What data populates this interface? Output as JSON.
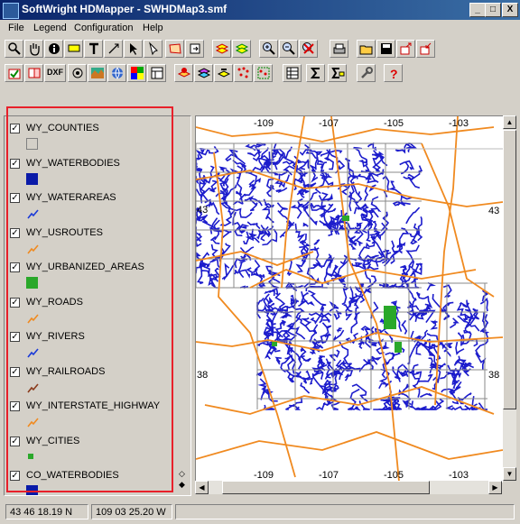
{
  "window": {
    "title": "SoftWright HDMapper - SWHDMap3.smf",
    "minimize": "_",
    "maximize": "□",
    "close": "X"
  },
  "menu": {
    "items": [
      "File",
      "Legend",
      "Configuration",
      "Help"
    ]
  },
  "toolbar1": [
    "zoom-window-icon",
    "pan-hand-icon",
    "info-icon",
    "label-icon",
    "text-tool-icon",
    "measure-icon",
    "select-arrow-icon",
    "edit-pointer-icon",
    "polygon-icon",
    "refresh-icon",
    "layers-up-icon",
    "layers-down-icon",
    "zoom-in-icon",
    "zoom-out-icon",
    "zoom-cancel-icon",
    "print-icon",
    "open-folder-icon",
    "save-icon",
    "export-icon",
    "import-icon"
  ],
  "toolbar2": {
    "dxf_label": "DXF",
    "icons": [
      "check-map-icon",
      "convert-icon",
      "dxf-icon",
      "target-icon",
      "terrain-icon",
      "globe-icon",
      "grid-color-icon",
      "layout-icon",
      "layer-add-icon",
      "layer-stack-icon",
      "layer-remove-icon",
      "points-icon",
      "points-select-icon",
      "table-icon",
      "sum-icon",
      "sum-select-icon",
      "wrench-icon",
      "help-question-icon"
    ]
  },
  "legend": {
    "layers": [
      {
        "name": "WY_COUNTIES",
        "checked": true,
        "symbol": "hollow-box",
        "color": "#d4d0c8"
      },
      {
        "name": "WY_WATERBODIES",
        "checked": true,
        "symbol": "fill-box",
        "color": "#0a1aa8"
      },
      {
        "name": "WY_WATERAREAS",
        "checked": true,
        "symbol": "line",
        "color": "#1a3ad8"
      },
      {
        "name": "WY_USROUTES",
        "checked": true,
        "symbol": "line",
        "color": "#f08a20"
      },
      {
        "name": "WY_URBANIZED_AREAS",
        "checked": true,
        "symbol": "fill-box",
        "color": "#2aa82a"
      },
      {
        "name": "WY_ROADS",
        "checked": true,
        "symbol": "line",
        "color": "#f08a20"
      },
      {
        "name": "WY_RIVERS",
        "checked": true,
        "symbol": "line",
        "color": "#1a3ad8"
      },
      {
        "name": "WY_RAILROADS",
        "checked": true,
        "symbol": "line",
        "color": "#8a3a1a"
      },
      {
        "name": "WY_INTERSTATE_HIGHWAY",
        "checked": true,
        "symbol": "line",
        "color": "#f08a20"
      },
      {
        "name": "WY_CITIES",
        "checked": true,
        "symbol": "dot",
        "color": "#2aa82a"
      },
      {
        "name": "CO_WATERBODIES",
        "checked": true,
        "symbol": "fill-box",
        "color": "#0a1aa8"
      }
    ]
  },
  "map": {
    "top_ticks": [
      "-109",
      "-107",
      "-105",
      "-103"
    ],
    "bottom_ticks": [
      "-109",
      "-107",
      "-105",
      "-103"
    ],
    "left_ticks": [
      "43",
      "38"
    ],
    "right_ticks": [
      "43",
      "38"
    ]
  },
  "status": {
    "coordinates": "43 46 18.19 N",
    "longitude": "109 03 25.20 W"
  },
  "colors": {
    "water": "#1c1ccc",
    "roads": "#f08a20",
    "grid": "#8a8a8a",
    "urban": "#2aa82a",
    "highlight": "#e8202a"
  }
}
